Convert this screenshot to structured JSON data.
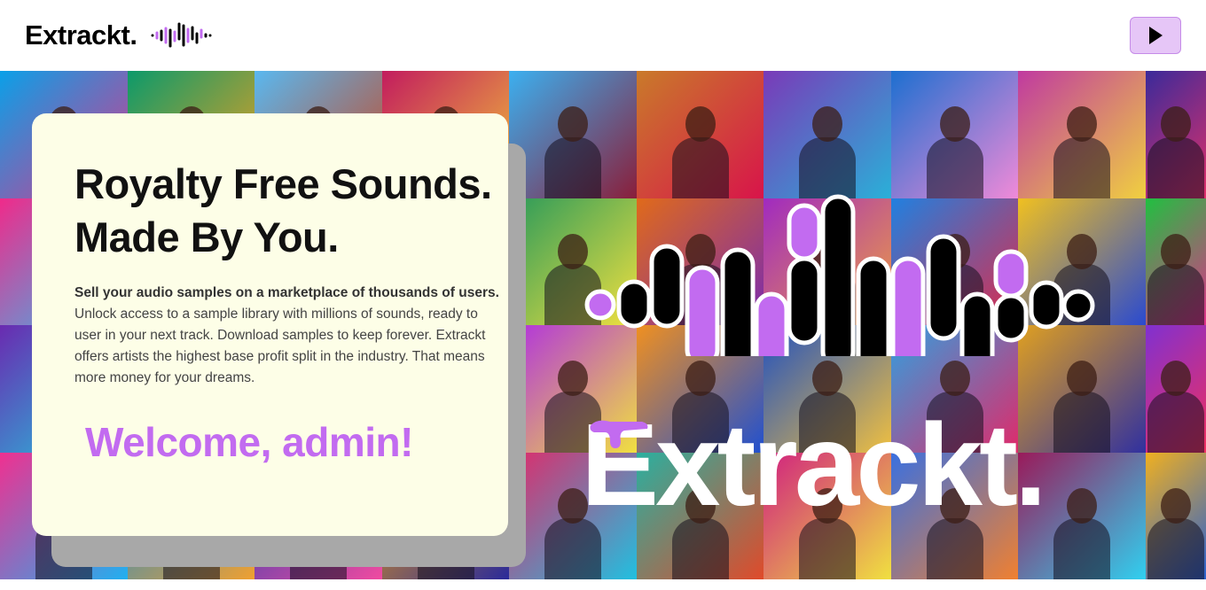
{
  "header": {
    "brand": "Extrackt.",
    "play_icon": "play-icon",
    "wave_icon": "soundwave-icon"
  },
  "hero": {
    "headline_line1": "Royalty Free Sounds.",
    "headline_line2": "Made By You.",
    "description_lead": "Sell your audio samples on a marketplace of thousands of users.",
    "description_body": "Unlock access to a sample library with millions of sounds, ready to user in your next track. Download samples to keep forever. Extrackt offers artists the highest base profit split in the industry. That means more money for your dreams.",
    "welcome": "Welcome, admin!",
    "big_logo_text": "Extrackt."
  },
  "colors": {
    "accent": "#c26bf0",
    "button_bg": "#e6c6f7",
    "card_bg": "#fdfee7"
  }
}
